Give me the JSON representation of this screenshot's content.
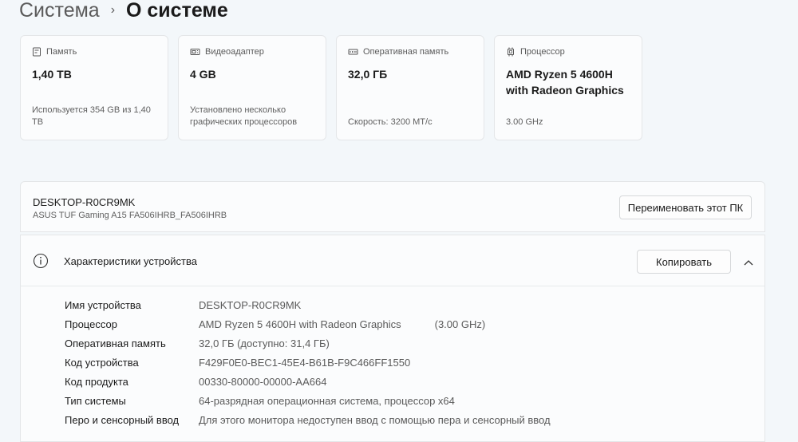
{
  "breadcrumb": {
    "parent": "Система",
    "separator": "›",
    "current": "О системе"
  },
  "cards": [
    {
      "icon": "storage-icon",
      "title": "Память",
      "value": "1,40 TB",
      "note": "Используется 354 GB из 1,40 TB"
    },
    {
      "icon": "gpu-icon",
      "title": "Видеоадаптер",
      "value": "4 GB",
      "note": "Установлено несколько графических процессоров"
    },
    {
      "icon": "ram-icon",
      "title": "Оперативная память",
      "value": "32,0 ГБ",
      "note": "Скорость: 3200 MT/c"
    },
    {
      "icon": "cpu-icon",
      "title": "Процессор",
      "value": "AMD Ryzen 5 4600H with Radeon Graphics",
      "note": "3.00 GHz"
    }
  ],
  "device": {
    "name": "DESKTOP-R0CR9MK",
    "model": "ASUS TUF Gaming A15 FA506IHRB_FA506IHRB",
    "rename_label": "Переименовать этот ПК"
  },
  "specs": {
    "icon": "info-icon",
    "title": "Характеристики устройства",
    "copy_label": "Копировать",
    "collapse_icon": "chevron-up-icon",
    "rows": [
      {
        "label": "Имя устройства",
        "value": "DESKTOP-R0CR9MK",
        "extra": ""
      },
      {
        "label": "Процессор",
        "value": "AMD Ryzen 5 4600H with Radeon Graphics",
        "extra": "(3.00 GHz)"
      },
      {
        "label": "Оперативная память",
        "value": "32,0 ГБ (доступно: 31,4 ГБ)",
        "extra": ""
      },
      {
        "label": "Код устройства",
        "value": "F429F0E0-BEC1-45E4-B61B-F9C466FF1550",
        "extra": ""
      },
      {
        "label": "Код продукта",
        "value": "00330-80000-00000-AA664",
        "extra": ""
      },
      {
        "label": "Тип системы",
        "value": "64-разрядная операционная система, процессор x64",
        "extra": ""
      },
      {
        "label": "Перо и сенсорный ввод",
        "value": "Для этого монитора недоступен ввод с помощью пера и сенсорный ввод",
        "extra": ""
      }
    ]
  },
  "colors": {
    "background": "#f3f7fa",
    "card": "#fbfcfd",
    "border": "#e4e6e8"
  }
}
